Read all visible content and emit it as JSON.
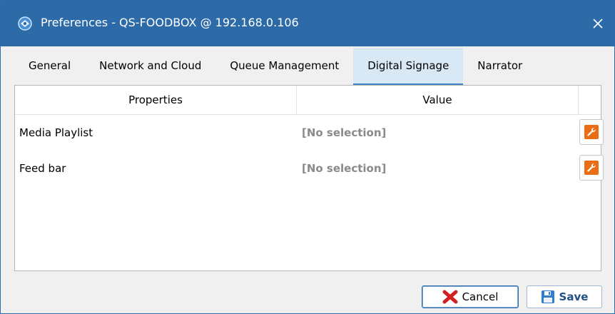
{
  "window": {
    "title": "Preferences - QS-FOODBOX @ 192.168.0.106",
    "close_label": "×",
    "colors": {
      "titlebar": "#2c6aa8",
      "accent": "#3b82c4",
      "wrench": "#ea6d13"
    }
  },
  "tabs": [
    {
      "label": "General",
      "active": false
    },
    {
      "label": "Network and Cloud",
      "active": false
    },
    {
      "label": "Queue Management",
      "active": false
    },
    {
      "label": "Digital Signage",
      "active": true
    },
    {
      "label": "Narrator",
      "active": false
    }
  ],
  "grid": {
    "headers": {
      "properties": "Properties",
      "value": "Value"
    },
    "rows": [
      {
        "property": "Media Playlist",
        "value": "[No selection]",
        "icon": "wrench-icon"
      },
      {
        "property": "Feed bar",
        "value": "[No selection]",
        "icon": "wrench-icon"
      }
    ]
  },
  "footer": {
    "cancel_label": "Cancel",
    "save_label": "Save"
  }
}
